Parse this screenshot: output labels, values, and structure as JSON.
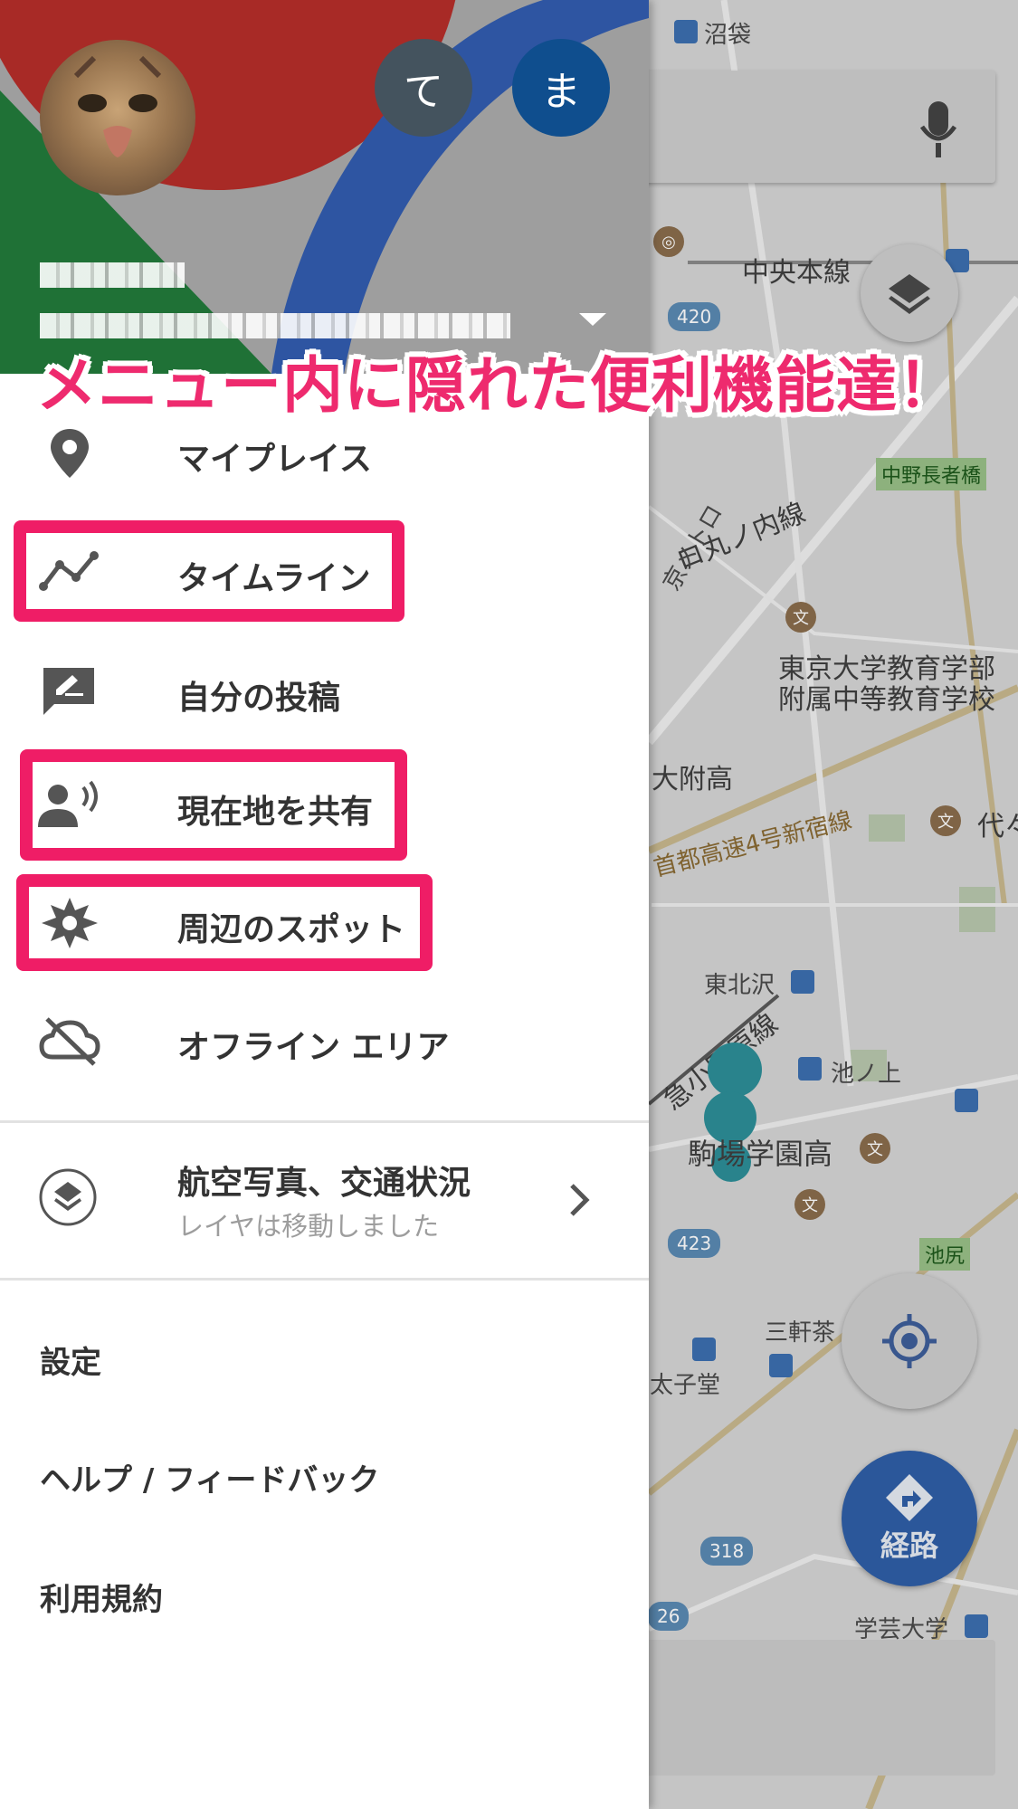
{
  "map": {
    "labels": {
      "numabukuro": "沼袋",
      "chuo_line": "中央本線",
      "nakano_choja": "中野長者橋",
      "marunouchi": "ロ丸ノ内線",
      "metro": "京メトロ",
      "todai_1": "東京大学教育学部",
      "todai_2": "附属中等教育学校",
      "daifu": "大附高",
      "expressway": "首都高速4号新宿線",
      "yoyogi": "代々",
      "higashikitazawa": "東北沢",
      "odakyu": "急小田原線",
      "ikenoue": "池ノ上",
      "komaba": "駒場学園高",
      "ikejiri": "池尻",
      "sangenjaya": "三軒茶",
      "taishido": "太子堂",
      "gakugei": "学芸大学",
      "route_420": "420",
      "route_423": "423",
      "route_318": "318",
      "route_26": "26"
    },
    "route_button_label": "経路"
  },
  "drawer": {
    "account_initials": [
      "て",
      "ま"
    ],
    "menu": {
      "my_places": "マイプレイス",
      "timeline": "タイムライン",
      "my_posts": "自分の投稿",
      "share_location": "現在地を共有",
      "nearby_spots": "周辺のスポット",
      "offline_areas": "オフライン エリア"
    },
    "layers": {
      "title": "航空写真、交通状況",
      "subtitle": "レイヤは移動しました"
    },
    "settings": "設定",
    "help": "ヘルプ / フィードバック",
    "terms": "利用規約"
  },
  "banner": "メニュー内に隠れた便利機能達！",
  "colors": {
    "highlight": "#ef1d66",
    "banner_text": "#ee2a6e",
    "route_fab": "#2f5fa8"
  }
}
